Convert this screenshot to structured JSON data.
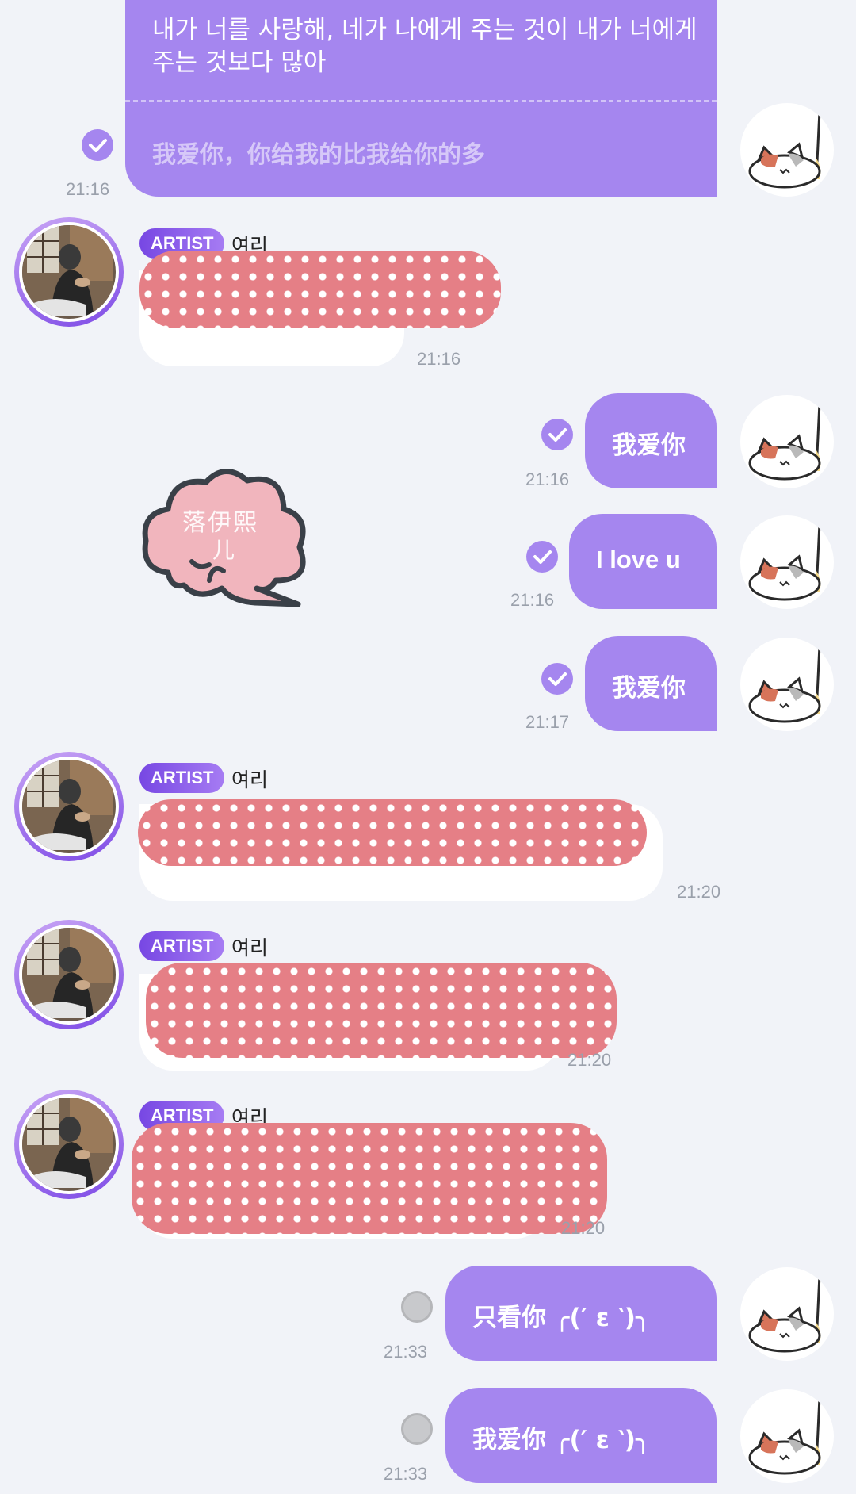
{
  "artist_name": "여리",
  "artist_badge": "ARTIST",
  "messages": {
    "m1": {
      "text": "내가 너를 사랑해, 네가 나에게 주는 것이 내가 너에게 주는 것보다 많아",
      "translation": "我爱你，你给我的比我给你的多",
      "time": "21:16"
    },
    "m2": {
      "time": "21:16"
    },
    "m3": {
      "text": "我爱你",
      "time": "21:16"
    },
    "m4": {
      "text": "I love u",
      "time": "21:16"
    },
    "m5": {
      "text": "我爱你",
      "time": "21:17"
    },
    "m6": {
      "time": "21:20"
    },
    "m7": {
      "time": "21:20"
    },
    "m8": {
      "time": "21:20"
    },
    "m9": {
      "text": "只看你 ╭(′ ε ‵)╮",
      "time": "21:33"
    },
    "m10": {
      "text": "我爱你 ╭(′ ε ‵)╮",
      "time": "21:33"
    }
  },
  "watermark": {
    "line1": "落伊熙",
    "line2": "儿"
  },
  "colors": {
    "background": "#f1f3f8",
    "outgoing_bubble": "#a586ef",
    "check": "#a586ef",
    "censor": "#e57f86",
    "time": "#9aa0ab"
  },
  "icons": [
    "check-icon",
    "pending-icon",
    "cat-avatar-icon",
    "artist-avatar-photo",
    "cloud-sticker"
  ]
}
